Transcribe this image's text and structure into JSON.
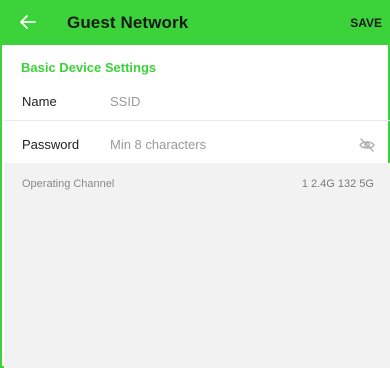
{
  "header": {
    "back_icon": "back-arrow-icon",
    "title": "Guest Network",
    "save_label": "SAVE",
    "accent_color": "#3cd33a"
  },
  "section": {
    "title": "Basic Device Settings"
  },
  "fields": {
    "name": {
      "label": "Name",
      "placeholder": "SSID"
    },
    "password": {
      "label": "Password",
      "placeholder": "Min 8 characters",
      "visibility_icon": "eye-off-icon"
    }
  },
  "operating_channel": {
    "label": "Operating Channel",
    "value": "1 2.4G   132 5G"
  }
}
